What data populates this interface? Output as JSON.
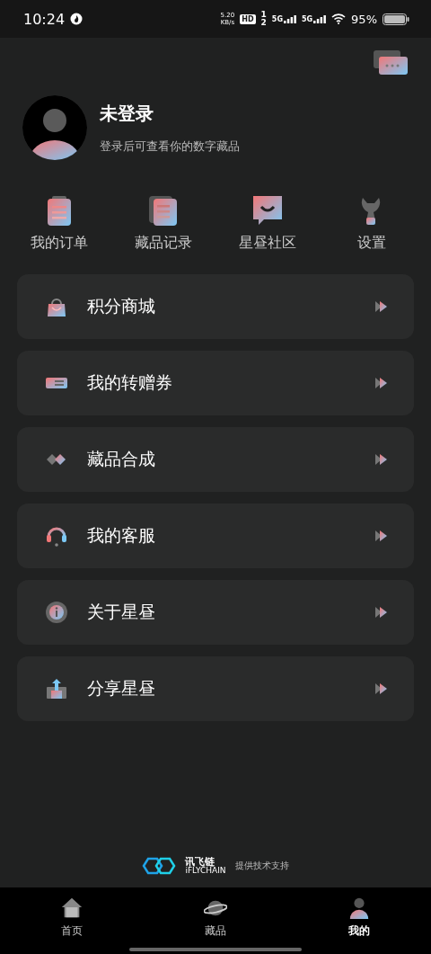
{
  "status_bar": {
    "time": "10:24",
    "net_speed": "5.20",
    "net_unit": "KB/s",
    "hd": "HD",
    "hd_sims": [
      "1",
      "2"
    ],
    "signals": [
      "5G",
      "5G"
    ],
    "battery": "95%"
  },
  "profile": {
    "name": "未登录",
    "hint": "登录后可查看你的数字藏品"
  },
  "shortcuts": [
    {
      "label": "我的订单"
    },
    {
      "label": "藏品记录"
    },
    {
      "label": "星昼社区"
    },
    {
      "label": "设置"
    }
  ],
  "menu": [
    {
      "label": "积分商城"
    },
    {
      "label": "我的转赠券"
    },
    {
      "label": "藏品合成"
    },
    {
      "label": "我的客服"
    },
    {
      "label": "关于星昼"
    },
    {
      "label": "分享星昼"
    }
  ],
  "footer": {
    "brand": "讯飞链",
    "brand_en": "iFLYCHAIN",
    "text": "提供技术支持"
  },
  "tabs": [
    {
      "label": "首页",
      "selected": false
    },
    {
      "label": "藏品",
      "selected": false
    },
    {
      "label": "我的",
      "selected": true
    }
  ]
}
